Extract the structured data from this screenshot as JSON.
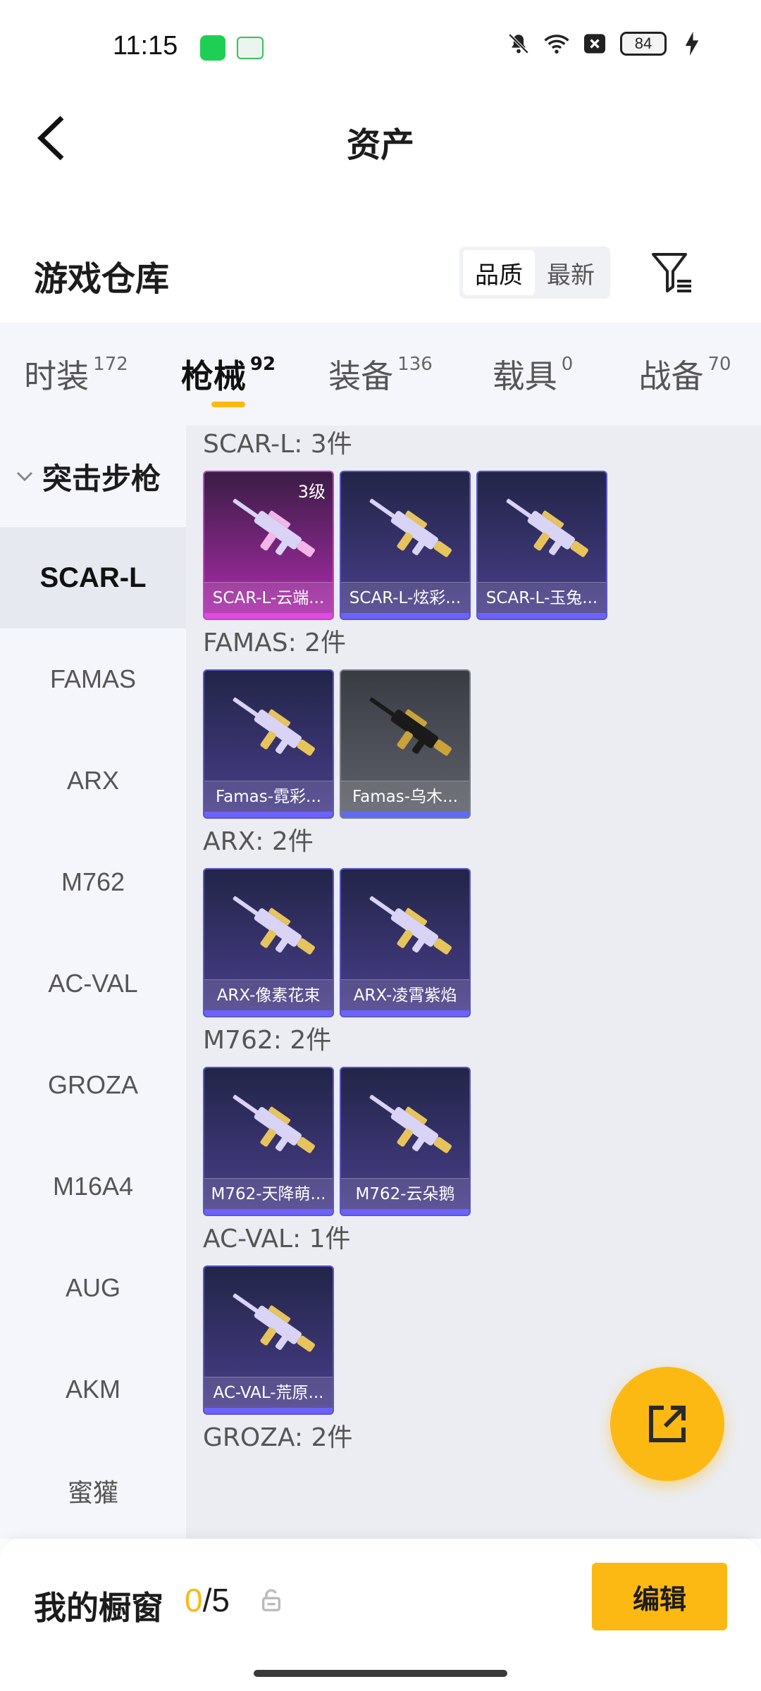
{
  "status_bar": {
    "time": "11:15",
    "battery": "84",
    "icons": [
      "app-icon-green",
      "app-icon-oppo",
      "mute-icon",
      "wifi-icon",
      "close-box-icon",
      "battery-icon",
      "charging-icon"
    ]
  },
  "header": {
    "title": "资产"
  },
  "warehouse": {
    "title": "游戏仓库",
    "sort": {
      "options": [
        "品质",
        "最新"
      ],
      "selected": "品质"
    }
  },
  "tabs": [
    {
      "label": "时装",
      "count": "172"
    },
    {
      "label": "枪械",
      "count": "92",
      "active": true
    },
    {
      "label": "装备",
      "count": "136"
    },
    {
      "label": "载具",
      "count": "0"
    },
    {
      "label": "战备",
      "count": "70"
    }
  ],
  "sidebar": {
    "category": "突击步枪",
    "items": [
      "SCAR-L",
      "FAMAS",
      "ARX",
      "M762",
      "AC-VAL",
      "GROZA",
      "M16A4",
      "AUG",
      "AKM",
      "蜜獾"
    ],
    "active": "SCAR-L"
  },
  "groups": [
    {
      "title": "SCAR-L: 3件",
      "items": [
        {
          "name": "SCAR-L-云端...",
          "badge": "3级",
          "style": "pink"
        },
        {
          "name": "SCAR-L-炫彩...",
          "badge": "",
          "style": "purple"
        },
        {
          "name": "SCAR-L-玉兔...",
          "badge": "",
          "style": "purple"
        }
      ]
    },
    {
      "title": "FAMAS: 2件",
      "items": [
        {
          "name": "Famas-霓彩...",
          "badge": "",
          "style": "purple"
        },
        {
          "name": "Famas-乌木...",
          "badge": "",
          "style": "gray"
        }
      ]
    },
    {
      "title": "ARX: 2件",
      "items": [
        {
          "name": "ARX-像素花束",
          "badge": "",
          "style": "purple"
        },
        {
          "name": "ARX-凌霄紫焰",
          "badge": "",
          "style": "purple"
        }
      ]
    },
    {
      "title": "M762: 2件",
      "items": [
        {
          "name": "M762-天降萌...",
          "badge": "",
          "style": "purple"
        },
        {
          "name": "M762-云朵鹅",
          "badge": "",
          "style": "purple"
        }
      ]
    },
    {
      "title": "AC-VAL: 1件",
      "items": [
        {
          "name": "AC-VAL-荒原...",
          "badge": "",
          "style": "purple"
        }
      ]
    },
    {
      "title": "GROZA: 2件",
      "items": []
    }
  ],
  "showcase": {
    "title": "我的橱窗",
    "current": "0",
    "separator": "/",
    "max": "5",
    "edit_label": "编辑"
  },
  "colors": {
    "accent": "#fdb913",
    "tab_bg": "#f4f6fb",
    "content_bg": "#ebedf2",
    "card_purple": "#4a3f8c",
    "card_pink": "#b02cae",
    "card_gray": "#5f626b"
  }
}
